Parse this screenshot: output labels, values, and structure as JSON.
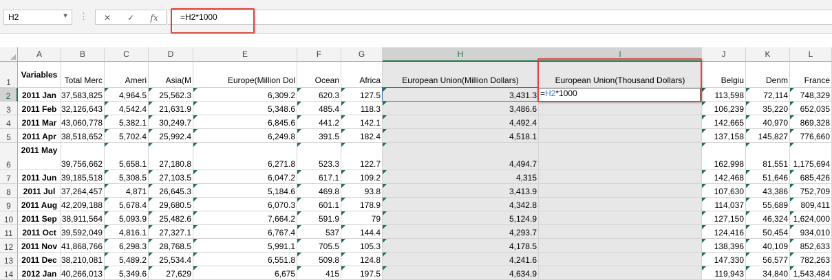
{
  "formula_bar": {
    "name_box": "H2",
    "cancel_icon": "✕",
    "enter_icon": "✓",
    "fx_label": "fx",
    "formula": "=H2*1000"
  },
  "edit_cell": {
    "ref": "H2",
    "rest": "*1000"
  },
  "colors": {
    "highlight": "#e0473f",
    "selection": "#217346",
    "shade": "#e7e7e7"
  },
  "columns": [
    "A",
    "B",
    "C",
    "D",
    "E",
    "F",
    "G",
    "H",
    "I",
    "J",
    "K",
    "L"
  ],
  "rows": [
    {
      "n": "1",
      "cells": [
        "Variables",
        "Total Merc",
        "Ameri",
        "Asia(M",
        "Europe(Million Dol",
        "Ocean",
        "Africa",
        "European Union(Million Dollars)",
        "European Union(Thousand Dollars)",
        "Belgiu",
        "Denm",
        "France"
      ]
    },
    {
      "n": "2",
      "cells": [
        "2011 Jan",
        "37,583,825",
        "4,964.5",
        "25,562.3",
        "6,309.2",
        "620.3",
        "127.5",
        "3,431.3",
        "",
        "113,598",
        "72,114",
        "748,329"
      ]
    },
    {
      "n": "3",
      "cells": [
        "2011 Feb",
        "32,126,643",
        "4,542.4",
        "21,631.9",
        "5,348.6",
        "485.4",
        "118.3",
        "3,486.6",
        "",
        "106,239",
        "35,220",
        "652,035"
      ]
    },
    {
      "n": "4",
      "cells": [
        "2011 Mar",
        "43,060,778",
        "5,382.1",
        "30,249.7",
        "6,845.6",
        "441.2",
        "142.1",
        "4,492.4",
        "",
        "142,665",
        "40,970",
        "869,328"
      ]
    },
    {
      "n": "5",
      "cells": [
        "2011 Apr",
        "38,518,652",
        "5,702.4",
        "25,992.4",
        "6,249.8",
        "391.5",
        "182.4",
        "4,518.1",
        "",
        "137,158",
        "145,827",
        "776,660"
      ]
    },
    {
      "n": "6",
      "cells": [
        "2011 May",
        "39,756,662",
        "5,658.1",
        "27,180.8",
        "6,271.8",
        "523.3",
        "122.7",
        "4,494.7",
        "",
        "162,998",
        "81,551",
        "1,175,694"
      ]
    },
    {
      "n": "7",
      "cells": [
        "2011 Jun",
        "39,185,518",
        "5,308.5",
        "27,103.5",
        "6,047.2",
        "617.1",
        "109.2",
        "4,315",
        "",
        "142,468",
        "51,646",
        "685,426"
      ]
    },
    {
      "n": "8",
      "cells": [
        "2011 Jul",
        "37,264,457",
        "4,871",
        "26,645.3",
        "5,184.6",
        "469.8",
        "93.8",
        "3,413.9",
        "",
        "107,630",
        "43,386",
        "752,709"
      ]
    },
    {
      "n": "9",
      "cells": [
        "2011 Aug",
        "42,209,188",
        "5,678.4",
        "29,680.5",
        "6,070.3",
        "601.1",
        "178.9",
        "4,342.8",
        "",
        "114,037",
        "55,689",
        "809,411"
      ]
    },
    {
      "n": "10",
      "cells": [
        "2011 Sep",
        "38,911,564",
        "5,093.9",
        "25,482.6",
        "7,664.2",
        "591.9",
        "79",
        "5,124.9",
        "",
        "127,150",
        "46,324",
        "1,624,000"
      ]
    },
    {
      "n": "11",
      "cells": [
        "2011 Oct",
        "39,592,049",
        "4,816.1",
        "27,327.1",
        "6,767.4",
        "537",
        "144.4",
        "4,293.7",
        "",
        "124,416",
        "50,454",
        "934,010"
      ]
    },
    {
      "n": "12",
      "cells": [
        "2011 Nov",
        "41,868,766",
        "6,298.3",
        "28,768.5",
        "5,991.1",
        "705.5",
        "105.3",
        "4,178.5",
        "",
        "138,396",
        "40,109",
        "852,633"
      ]
    },
    {
      "n": "13",
      "cells": [
        "2011 Dec",
        "38,210,081",
        "5,489.2",
        "25,534.4",
        "6,551.8",
        "509.8",
        "124.8",
        "4,241.6",
        "",
        "147,330",
        "56,577",
        "782,263"
      ]
    },
    {
      "n": "14",
      "cells": [
        "2012 Jan",
        "40,266,013",
        "5,349.6",
        "27,629",
        "6,675",
        "415",
        "197.5",
        "4,634.9",
        "",
        "119,943",
        "34,840",
        "1,543,484"
      ]
    }
  ]
}
